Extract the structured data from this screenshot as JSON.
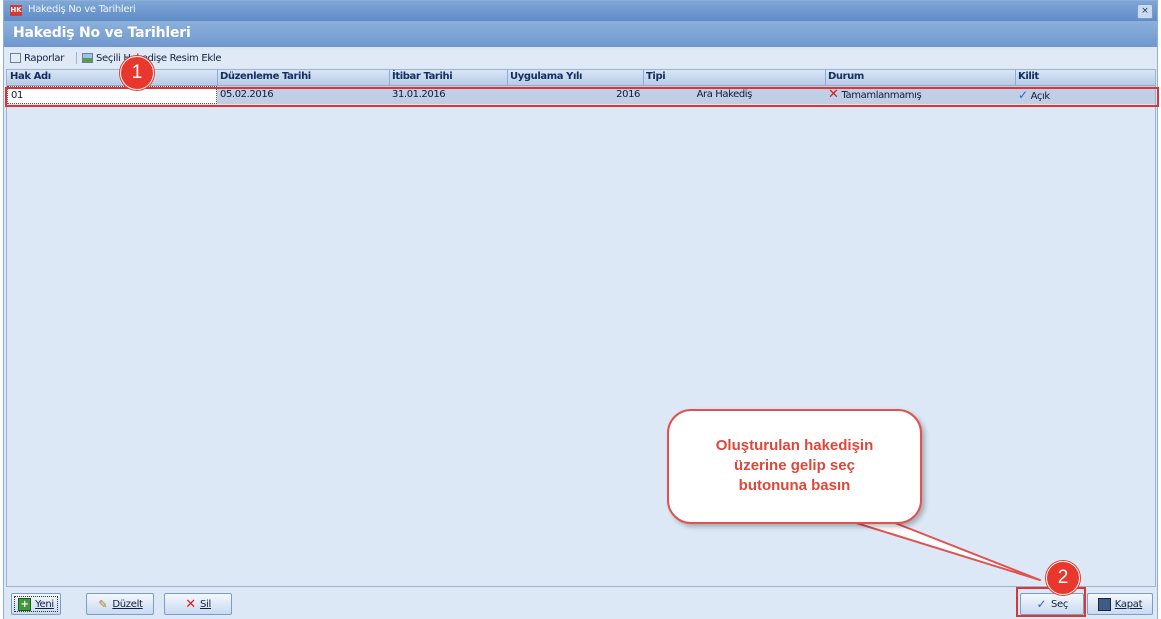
{
  "window": {
    "title": "Hakediş No ve Tarihleri",
    "app_icon": "HK",
    "close_glyph": "×"
  },
  "header": {
    "title": "Hakediş No ve Tarihleri"
  },
  "toolbar": {
    "reports_label": "Raporlar",
    "add_image_label": "Seçili Hakedişe Resim Ekle"
  },
  "table": {
    "columns": [
      "Hak Adı",
      "Düzenleme Tarihi",
      "İtibar Tarihi",
      "Uygulama Yılı",
      "Tipi",
      "Durum",
      "Kilit"
    ],
    "rows": [
      {
        "hak_adi": "01",
        "duzenleme_tarihi": "05.02.2016",
        "itibar_tarihi": "31.01.2016",
        "uygulama_yili": "2016",
        "tipi": "Ara Hakediş",
        "durum": "Tamamlanmamış",
        "kilit": "Açık"
      }
    ]
  },
  "annotations": {
    "badge_1": "1",
    "badge_2": "2",
    "callout_lines": [
      "Oluşturulan hakedişin",
      "üzerine gelip seç",
      "butonuna basın"
    ]
  },
  "buttons": {
    "new": "Yeni",
    "edit": "Düzelt",
    "delete": "Sil",
    "select": "Seç",
    "close": "Kapat"
  },
  "colors": {
    "annotation_red": "#e03434",
    "titlebar": "#6f98cf",
    "selected_row": "#bfd0e6"
  }
}
